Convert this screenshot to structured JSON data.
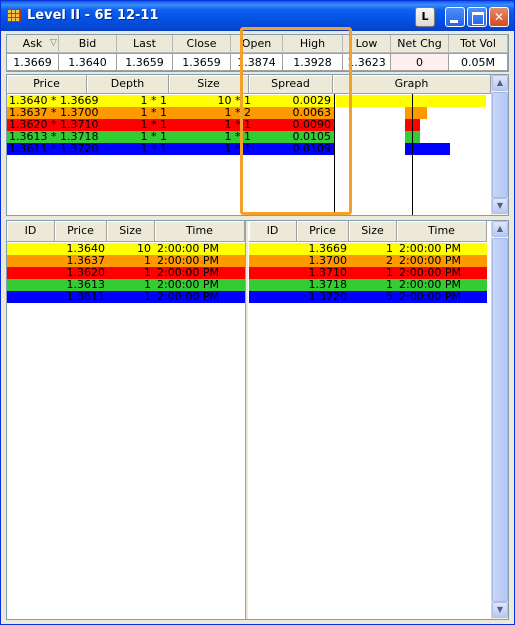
{
  "window": {
    "title": "Level II - 6E 12-11",
    "l_button": "L"
  },
  "summary": {
    "headers": [
      "Ask",
      "Bid",
      "Last",
      "Close",
      "Open",
      "High",
      "Low",
      "Net Chg",
      "Tot Vol"
    ],
    "values": [
      "1.3669",
      "1.3640",
      "1.3659",
      "1.3659",
      "1.3874",
      "1.3928",
      "1.3623",
      "0",
      "0.05M"
    ]
  },
  "depth": {
    "headers": [
      "Price",
      "Depth",
      "Size",
      "Spread",
      "Graph"
    ],
    "rows": [
      {
        "price": "1.3640 * 1.3669",
        "depth": "1 * 1",
        "size": "10 * 1",
        "spread": "0.0029",
        "color": "#ffff00",
        "text_color": "#000000",
        "graph": 1.0
      },
      {
        "price": "1.3637 * 1.3700",
        "depth": "1 * 1",
        "size": "1 * 2",
        "spread": "0.0063",
        "color": "#ff9900",
        "text_color": "#000000",
        "graph": 0.22
      },
      {
        "price": "1.3620 * 1.3710",
        "depth": "1 * 1",
        "size": "1 * 1",
        "spread": "0.0090",
        "color": "#ff0000",
        "text_color": "#000000",
        "graph": 0.15
      },
      {
        "price": "1.3613 * 1.3718",
        "depth": "1 * 1",
        "size": "1 * 1",
        "spread": "0.0105",
        "color": "#33cc33",
        "text_color": "#000000",
        "graph": 0.15
      },
      {
        "price": "1.3611 * 1.3720",
        "depth": "1 * 1",
        "size": "1 * 1",
        "spread": "0.0109",
        "color": "#0000ff",
        "text_color": "#000000",
        "graph": 0.45
      }
    ]
  },
  "bid_book": {
    "headers": [
      "ID",
      "Price",
      "Size",
      "Time"
    ],
    "rows": [
      {
        "id": "",
        "price": "1.3640",
        "size": "10",
        "time": "2:00:00 PM",
        "color": "#ffff00"
      },
      {
        "id": "",
        "price": "1.3637",
        "size": "1",
        "time": "2:00:00 PM",
        "color": "#ff9900"
      },
      {
        "id": "",
        "price": "1.3620",
        "size": "1",
        "time": "2:00:00 PM",
        "color": "#ff0000"
      },
      {
        "id": "",
        "price": "1.3613",
        "size": "1",
        "time": "2:00:00 PM",
        "color": "#33cc33"
      },
      {
        "id": "",
        "price": "1.3611",
        "size": "1",
        "time": "2:00:00 PM",
        "color": "#0000ff"
      }
    ]
  },
  "ask_book": {
    "headers": [
      "ID",
      "Price",
      "Size",
      "Time"
    ],
    "rows": [
      {
        "id": "",
        "price": "1.3669",
        "size": "1",
        "time": "2:00:00 PM",
        "color": "#ffff00"
      },
      {
        "id": "",
        "price": "1.3700",
        "size": "2",
        "time": "2:00:00 PM",
        "color": "#ff9900"
      },
      {
        "id": "",
        "price": "1.3710",
        "size": "1",
        "time": "2:00:00 PM",
        "color": "#ff0000"
      },
      {
        "id": "",
        "price": "1.3718",
        "size": "1",
        "time": "2:00:00 PM",
        "color": "#33cc33"
      },
      {
        "id": "",
        "price": "1.3720",
        "size": "5",
        "time": "2:00:00 PM",
        "color": "#0000ff"
      }
    ]
  },
  "colors": {
    "highlight": "#f4a12c",
    "titlebar": "#0452e4"
  },
  "icons": {
    "app": "grid-app-icon",
    "minimize": "minimize-icon",
    "maximize": "maximize-icon",
    "close": "close-icon",
    "scroll_up": "arrow-up-icon",
    "scroll_down": "arrow-down-icon"
  }
}
